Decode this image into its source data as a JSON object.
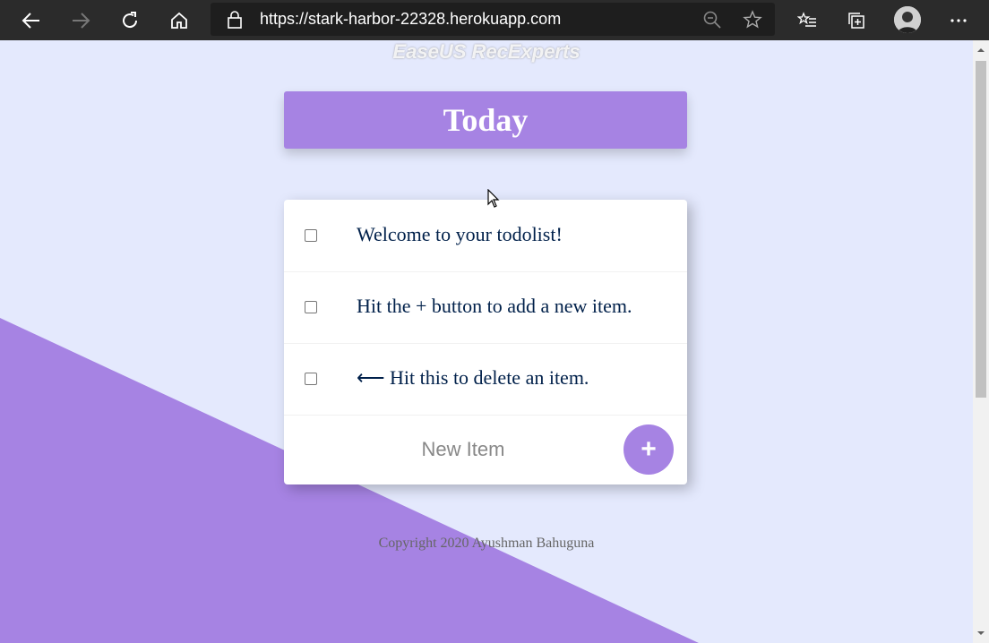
{
  "browser": {
    "url": "https://stark-harbor-22328.herokuapp.com",
    "icons": [
      "back-icon",
      "forward-icon",
      "refresh-icon",
      "home-icon",
      "lock-icon",
      "zoom-icon",
      "favorite-star-icon",
      "favorites-list-icon",
      "collections-icon",
      "profile-avatar",
      "more-icon"
    ]
  },
  "watermark": "EaseUS RecExperts",
  "heading": "Today",
  "items": [
    {
      "label": "Welcome to your todolist!"
    },
    {
      "label": "Hit the + button to add a new item."
    },
    {
      "label": "⟵ Hit this to delete an item."
    }
  ],
  "new_item": {
    "placeholder": "New Item",
    "button_label": "+"
  },
  "footer": "Copyright 2020 Ayushman Bahuguna",
  "colors": {
    "accent": "#A683E3",
    "background": "#E4E9FD",
    "text": "#00204A"
  }
}
